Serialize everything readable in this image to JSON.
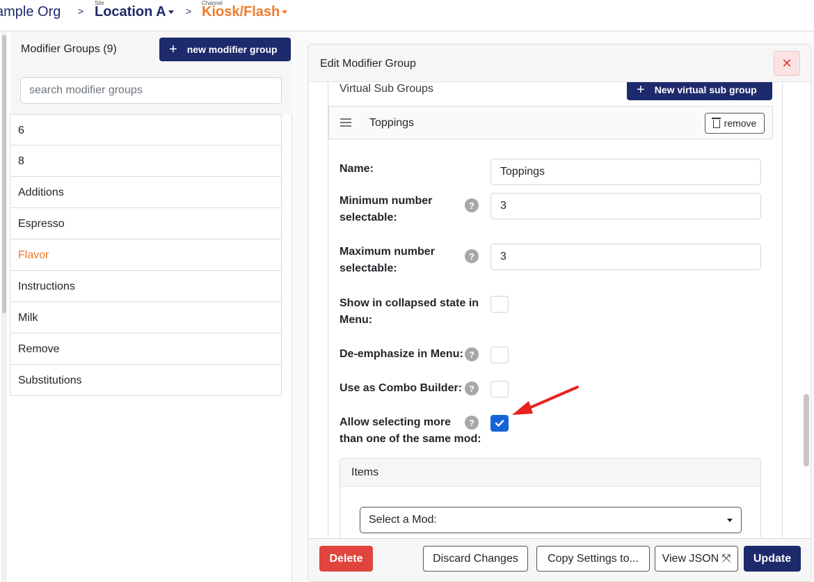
{
  "breadcrumb": {
    "org": "ample Org",
    "separator": ">",
    "site_label": "Site",
    "site": "Location A",
    "channel_label": "Channel",
    "channel": "Kiosk/Flash"
  },
  "left_panel": {
    "title": "Modifier Groups (9)",
    "new_button": "new modifier group",
    "search_placeholder": "search modifier groups",
    "groups": [
      "6",
      "8",
      "Additions",
      "Espresso",
      "Flavor",
      "Instructions",
      "Milk",
      "Remove",
      "Substitutions"
    ],
    "active_group": "Flavor"
  },
  "modal": {
    "title": "Edit Modifier Group",
    "close_symbol": "✕",
    "virtual_sub_groups": {
      "title": "Virtual Sub Groups",
      "new_button": "New virtual sub group"
    },
    "sub_group": {
      "name": "Toppings",
      "remove_label": "remove"
    },
    "fields": {
      "name_label": "Name:",
      "name_value": "Toppings",
      "min_label_1": "Minimum number",
      "min_label_2": "selectable:",
      "min_value": "3",
      "max_label_1": "Maximum number",
      "max_label_2": "selectable:",
      "max_value": "3",
      "collapsed_label_1": "Show in collapsed state in",
      "collapsed_label_2": "Menu:",
      "collapsed_checked": false,
      "deemphasize_label": "De-emphasize in Menu:",
      "deemphasize_checked": false,
      "combo_label": "Use as Combo Builder:",
      "combo_checked": false,
      "allow_multi_label_1": "Allow selecting more",
      "allow_multi_label_2": "than one of the same mod:",
      "allow_multi_checked": true,
      "help_symbol": "?"
    },
    "items": {
      "title": "Items",
      "select_placeholder": "Select a Mod:"
    },
    "footer": {
      "delete": "Delete",
      "discard": "Discard Changes",
      "copy": "Copy Settings to...",
      "view_json": "View JSON ⤧",
      "update": "Update"
    }
  },
  "colors": {
    "navy": "#1d2a6b",
    "orange": "#f07a2a",
    "danger": "#e0443d",
    "checkbox_blue": "#1565d8",
    "annotation_red": "#e8211c"
  }
}
